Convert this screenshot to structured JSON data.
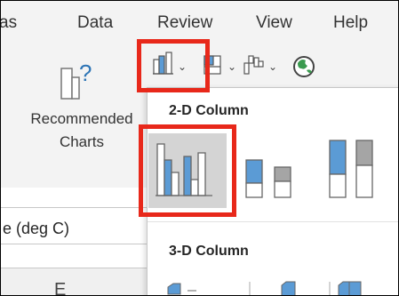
{
  "ribbon": {
    "tabs": [
      "as",
      "Data",
      "Review",
      "View",
      "Help"
    ],
    "recommended_charts": {
      "label_line1": "Recommended",
      "label_line2": "Charts"
    }
  },
  "sheet": {
    "cell_text": "e (deg C)",
    "column_letter": "E"
  },
  "chart_buttons": [
    "column-chart",
    "hierarchy-chart",
    "waterfall-chart",
    "map-chart"
  ],
  "dropdown": {
    "section_2d": "2-D Column",
    "section_3d": "3-D Column",
    "options_2d": [
      "Clustered Column",
      "Stacked Column",
      "100% Stacked Column"
    ],
    "selected": "Clustered Column"
  },
  "colors": {
    "highlight": "#e8281a",
    "chart_blue": "#5b9bd5",
    "chart_gray": "#a5a5a5"
  }
}
